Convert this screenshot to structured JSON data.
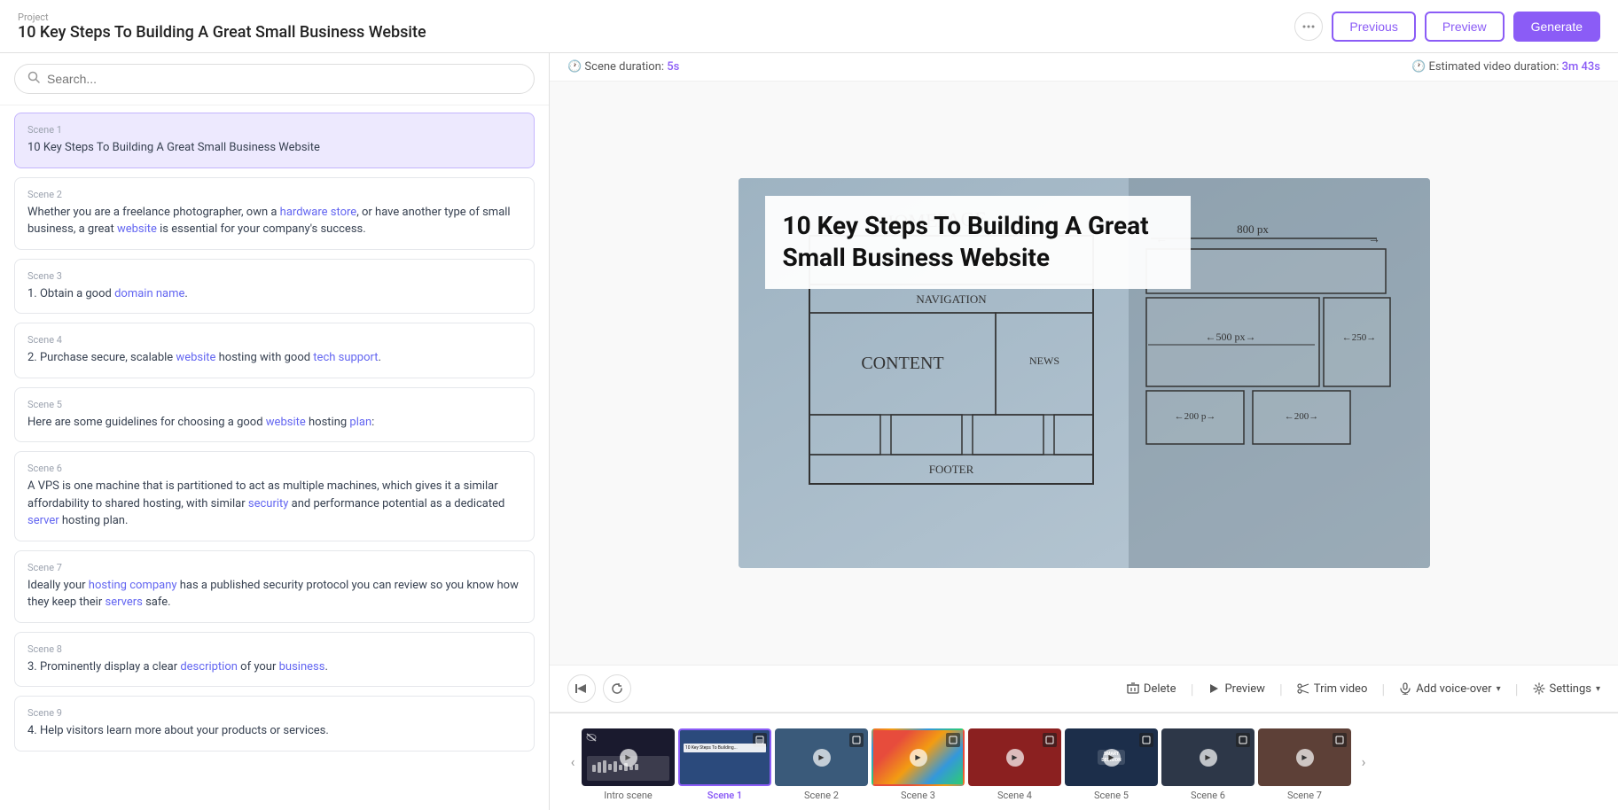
{
  "header": {
    "project_label": "Project",
    "title": "10 Key Steps To Building A Great Small Business Website",
    "btn_previous": "Previous",
    "btn_preview": "Preview",
    "btn_generate": "Generate"
  },
  "search": {
    "placeholder": "Search..."
  },
  "duration": {
    "scene_label": "Scene duration:",
    "scene_value": "5s",
    "estimated_label": "Estimated video duration:",
    "estimated_value": "3m 43s"
  },
  "slide": {
    "title": "10 Key Steps To Building A Great Small Business Website"
  },
  "controls": {
    "delete_label": "Delete",
    "preview_label": "Preview",
    "trim_label": "Trim video",
    "voice_label": "Add voice-over",
    "settings_label": "Settings"
  },
  "scenes": [
    {
      "id": "scene-1",
      "label": "Scene 1",
      "text": "10 Key Steps To Building A Great Small Business Website",
      "active": true,
      "links": []
    },
    {
      "id": "scene-2",
      "label": "Scene 2",
      "text": "Whether you are a freelance photographer, own a hardware store, or have another type of small business, a great website is essential for your company's success.",
      "active": false,
      "links": [
        "hardware store",
        "website"
      ]
    },
    {
      "id": "scene-3",
      "label": "Scene 3",
      "text": "1. Obtain a good domain name.",
      "active": false,
      "links": [
        "domain name"
      ]
    },
    {
      "id": "scene-4",
      "label": "Scene 4",
      "text": "2. Purchase secure, scalable website hosting with good tech support.",
      "active": false,
      "links": [
        "website",
        "tech support"
      ]
    },
    {
      "id": "scene-5",
      "label": "Scene 5",
      "text": "Here are some guidelines for choosing a good website hosting plan:",
      "active": false,
      "links": [
        "website",
        "plan"
      ]
    },
    {
      "id": "scene-6",
      "label": "Scene 6",
      "text": "A VPS is one machine that is partitioned to act as multiple machines, which gives it a similar affordability to shared hosting, with similar security and performance potential as a dedicated server hosting plan.",
      "active": false,
      "links": [
        "security",
        "server"
      ]
    },
    {
      "id": "scene-7",
      "label": "Scene 7",
      "text": "Ideally your hosting company has a published security protocol you can review so you know how they keep their servers safe.",
      "active": false,
      "links": [
        "hosting company",
        "servers"
      ]
    },
    {
      "id": "scene-8",
      "label": "Scene 8",
      "text": "3. Prominently display a clear description of your business.",
      "active": false,
      "links": [
        "description",
        "business"
      ]
    },
    {
      "id": "scene-9",
      "label": "Scene 9",
      "text": "4. Help visitors learn more about your products or services.",
      "active": false,
      "links": []
    }
  ],
  "filmstrip": {
    "items": [
      {
        "id": "intro",
        "label": "Intro scene",
        "color": "dark",
        "active": false
      },
      {
        "id": "scene1",
        "label": "Scene 1",
        "color": "blue",
        "active": true
      },
      {
        "id": "scene2",
        "label": "Scene 2",
        "color": "blue2",
        "active": false
      },
      {
        "id": "scene3",
        "label": "Scene 3",
        "color": "colorful",
        "active": false
      },
      {
        "id": "scene4",
        "label": "Scene 4",
        "color": "red",
        "active": false
      },
      {
        "id": "scene5",
        "label": "Scene 5",
        "color": "decision",
        "active": false
      },
      {
        "id": "scene6",
        "label": "Scene 6",
        "color": "text",
        "active": false
      },
      {
        "id": "scene7",
        "label": "Scene 7",
        "color": "brown",
        "active": false
      }
    ]
  }
}
